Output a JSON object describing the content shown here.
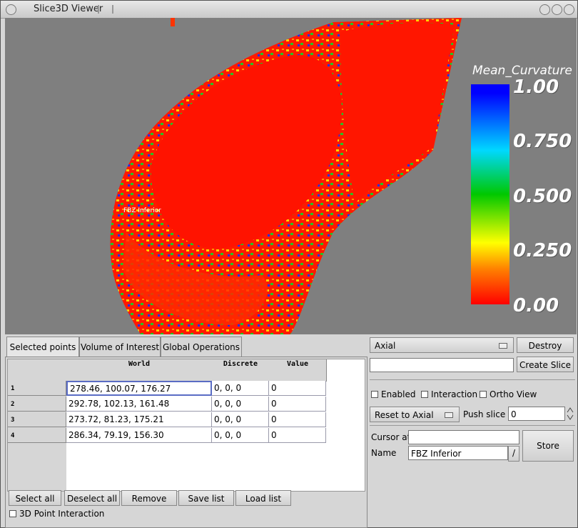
{
  "window": {
    "title": "Slice3D Viewer"
  },
  "viewport": {
    "colorbar_title": "Mean_Curvature",
    "colorbar_ticks": [
      "1.00",
      "0.750",
      "0.500",
      "0.250",
      "0.00"
    ],
    "landmark_label": "FBZ Inferior"
  },
  "tabs": [
    "Selected points",
    "Volume of Interest",
    "Global Operations"
  ],
  "table": {
    "columns": [
      "World",
      "Discrete",
      "Value"
    ],
    "rows": [
      {
        "id": "1",
        "world": "278.46, 100.07, 176.27",
        "discrete": "0, 0, 0",
        "value": "0"
      },
      {
        "id": "2",
        "world": "292.78, 102.13, 161.48",
        "discrete": "0, 0, 0",
        "value": "0"
      },
      {
        "id": "3",
        "world": "273.72, 81.23, 175.21",
        "discrete": "0, 0, 0",
        "value": "0"
      },
      {
        "id": "4",
        "world": "286.34, 79.19, 156.30",
        "discrete": "0, 0, 0",
        "value": "0"
      }
    ]
  },
  "buttons": {
    "select_all": "Select all",
    "deselect_all": "Deselect all",
    "remove": "Remove",
    "save_list": "Save list",
    "load_list": "Load list"
  },
  "point_interaction_label": "3D Point Interaction",
  "right": {
    "orientation_value": "Axial",
    "destroy_slice": "Destroy Slice",
    "create_slice": "Create Slice",
    "slice_name_value": "",
    "enabled_label": "Enabled",
    "interaction_label": "Interaction",
    "ortho_label": "Ortho View",
    "reset_value": "Reset to Axial",
    "push_slice_label": "Push slice",
    "push_slice_value": "0",
    "cursor_label": "Cursor at",
    "cursor_value": "",
    "name_label": "Name",
    "name_value": "FBZ Inferior",
    "store": "Store"
  }
}
